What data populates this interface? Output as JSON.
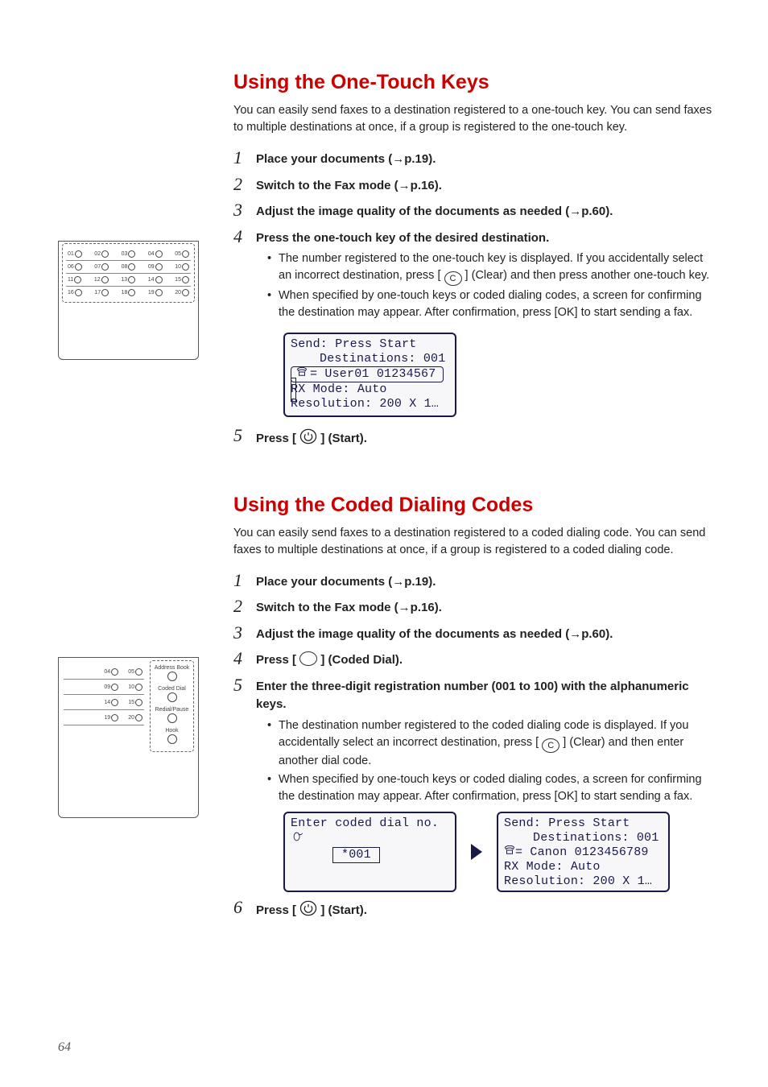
{
  "page_number": "64",
  "section1": {
    "title": "Using the One-Touch Keys",
    "intro": "You can easily send faxes to a destination registered to a one-touch key. You can send faxes to multiple destinations at once, if a group is registered to the one-touch key.",
    "steps": {
      "s1": "Place your documents (→p.19).",
      "s2": "Switch to the Fax mode (→p.16).",
      "s3": "Adjust the image quality of the documents as needed (→p.60).",
      "s4": "Press the one-touch key of the desired destination.",
      "s4_b1a": "The number registered to the one-touch key is displayed. If you accidentally select an incorrect destination, press [ ",
      "s4_b1b": " ] (Clear) and then press another one-touch key.",
      "s4_b2": "When specified by one-touch keys or coded dialing codes, a screen for confirming the destination may appear. After confirmation, press [OK] to start sending a fax.",
      "s5a": "Press [ ",
      "s5b": " ] (Start)."
    },
    "lcd": {
      "r1": "Send: Press Start",
      "r2": "Destinations: 001",
      "r3": "User01 01234567",
      "r4": "RX Mode: Auto",
      "r5": "Resolution: 200 X 1…"
    }
  },
  "section2": {
    "title": "Using the Coded Dialing Codes",
    "intro": "You can easily send faxes to a destination registered to a coded dialing code. You can send faxes to multiple destinations at once, if a group is registered to a coded dialing code.",
    "steps": {
      "s1": "Place your documents (→p.19).",
      "s2": "Switch to the Fax mode (→p.16).",
      "s3": "Adjust the image quality of the documents as needed (→p.60).",
      "s4a": "Press [ ",
      "s4b": " ] (Coded Dial).",
      "s5": "Enter the three-digit registration number (001 to 100) with the alphanumeric keys.",
      "s5_b1a": "The destination number registered to the coded dialing code is displayed. If you accidentally select an incorrect destination, press [ ",
      "s5_b1b": " ] (Clear) and then enter another dial code.",
      "s5_b2": "When specified by one-touch keys or coded dialing codes, a screen for confirming the destination may appear. After confirmation, press [OK] to start sending a fax.",
      "s6a": "Press [ ",
      "s6b": " ] (Start)."
    },
    "lcd_left": {
      "r1": "Enter coded dial no.",
      "boxed": "*001"
    },
    "lcd_right": {
      "r1": "Send: Press Start",
      "r2": "Destinations: 001",
      "r3": "Canon 0123456789",
      "r4": "RX Mode: Auto",
      "r5": "Resolution: 200 X 1…"
    }
  },
  "sidekeys": {
    "lab1": "Address Book",
    "lab2": "Coded Dial",
    "lab3": "Redial/Pause",
    "lab4": "Hook"
  },
  "keypad_numbers": [
    [
      "01",
      "02",
      "03",
      "04",
      "05"
    ],
    [
      "06",
      "07",
      "08",
      "09",
      "10"
    ],
    [
      "11",
      "12",
      "13",
      "14",
      "15"
    ],
    [
      "16",
      "17",
      "18",
      "19",
      "20"
    ]
  ],
  "side_pairs": [
    [
      "04",
      "05"
    ],
    [
      "09",
      "10"
    ],
    [
      "14",
      "15"
    ],
    [
      "19",
      "20"
    ]
  ],
  "icons": {
    "clear_letter": "C"
  }
}
